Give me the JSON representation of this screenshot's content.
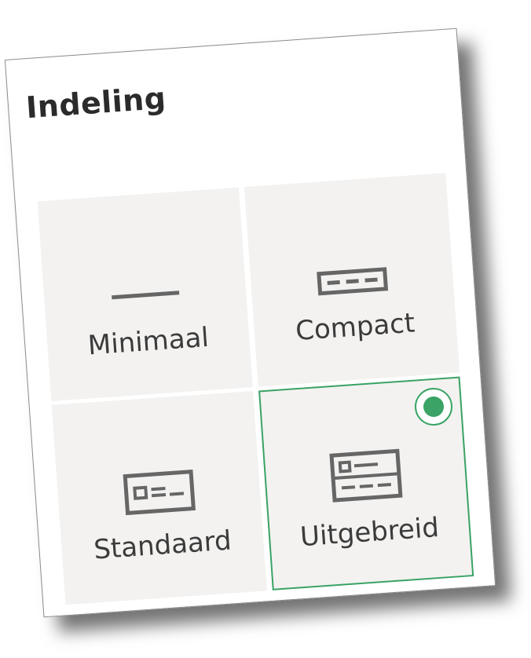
{
  "panel": {
    "title": "Indeling"
  },
  "layout_options": [
    {
      "label": "Minimaal",
      "icon": "minimal-layout-icon",
      "selected": false
    },
    {
      "label": "Compact",
      "icon": "compact-layout-icon",
      "selected": false
    },
    {
      "label": "Standaard",
      "icon": "standard-layout-icon",
      "selected": false
    },
    {
      "label": "Uitgebreid",
      "icon": "extended-layout-icon",
      "selected": true
    }
  ],
  "colors": {
    "selected_accent": "#3aa365",
    "tile_background": "#f3f2f1",
    "icon_color": "#666666",
    "text_color": "#3b3b3b"
  }
}
